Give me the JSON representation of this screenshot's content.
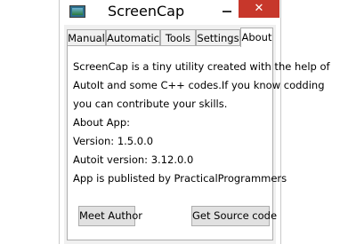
{
  "window": {
    "title": "ScreenCap",
    "close_glyph": "✕",
    "icon": "screencap-app-icon"
  },
  "tabs": [
    {
      "label": "Manual",
      "active": false
    },
    {
      "label": "Automatic",
      "active": false
    },
    {
      "label": "Tools",
      "active": false
    },
    {
      "label": "Settings",
      "active": false
    },
    {
      "label": "About",
      "active": true
    }
  ],
  "about": {
    "lines": [
      "ScreenCap is a tiny utility created with the help of",
      "AutoIt and some C++ codes.If you know codding",
      "you can contribute your skills.",
      "About App:",
      "Version: 1.5.0.0",
      "Autoit version: 3.12.0.0",
      "App is publisted by PracticalProgrammers"
    ]
  },
  "buttons": {
    "meet_author": "Meet Author",
    "get_source": "Get Source code"
  },
  "colors": {
    "close_button": "#c7372b",
    "client_background": "#f0f0f0",
    "button_face": "#e1e1e1"
  }
}
